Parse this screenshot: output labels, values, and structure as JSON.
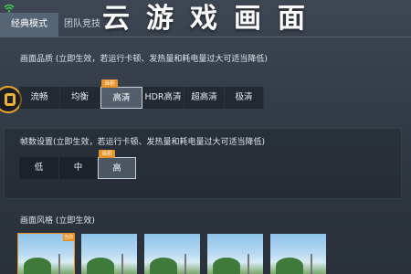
{
  "tabs": [
    {
      "label": "经典模式",
      "active": true
    },
    {
      "label": "团队竞技",
      "active": false
    }
  ],
  "banner": "云游戏画面",
  "quality": {
    "label": "画面品质 (立即生效，若运行卡顿、发热量和耗电量过大可适当降低)",
    "options": [
      "流畅",
      "均衡",
      "高清",
      "HDR高清",
      "超高清",
      "极清"
    ],
    "selected": "高清",
    "tag": "当前"
  },
  "fps": {
    "label": "帧数设置(立即生效，若运行卡顿、发热量和耗电量过大可适当降低)",
    "options": [
      "低",
      "中",
      "高"
    ],
    "selected": "高",
    "tag": "当前"
  },
  "style": {
    "label": "画面风格 (立即生效)",
    "thumb_tag": "当前"
  },
  "colors": {
    "accent": "#e8922a",
    "wifi": "#3ccf4e"
  }
}
